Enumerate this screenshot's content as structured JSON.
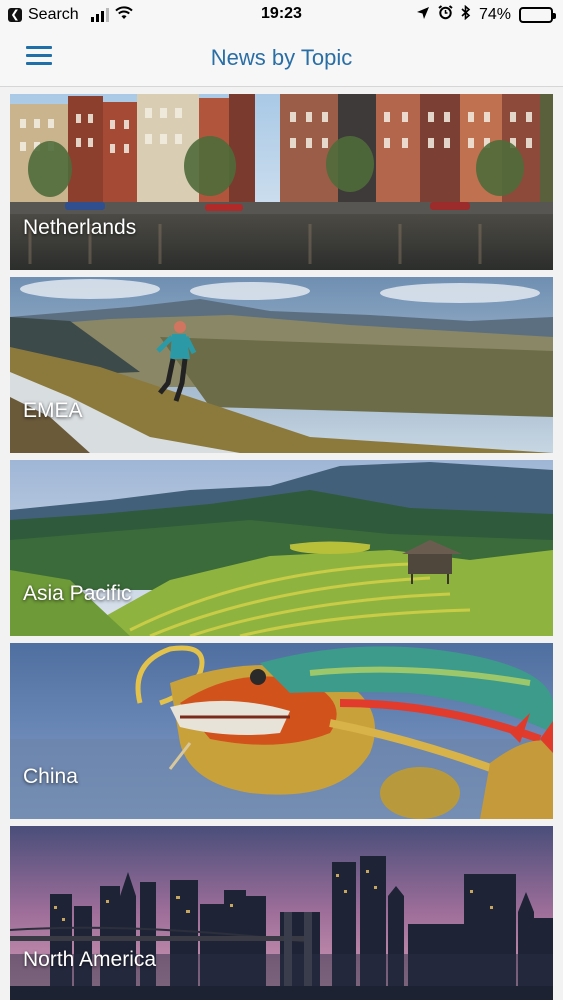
{
  "status_bar": {
    "back_app": "Search",
    "time": "19:23",
    "battery": "74%",
    "battery_level": 0.74
  },
  "header": {
    "title": "News by Topic",
    "menu_icon": "hamburger-menu-icon"
  },
  "topics": [
    {
      "label": "Netherlands"
    },
    {
      "label": "EMEA"
    },
    {
      "label": "Asia Pacific"
    },
    {
      "label": "China"
    },
    {
      "label": "North America"
    }
  ],
  "colors": {
    "accent": "#2a6ea6",
    "background": "#f2f2f2"
  }
}
